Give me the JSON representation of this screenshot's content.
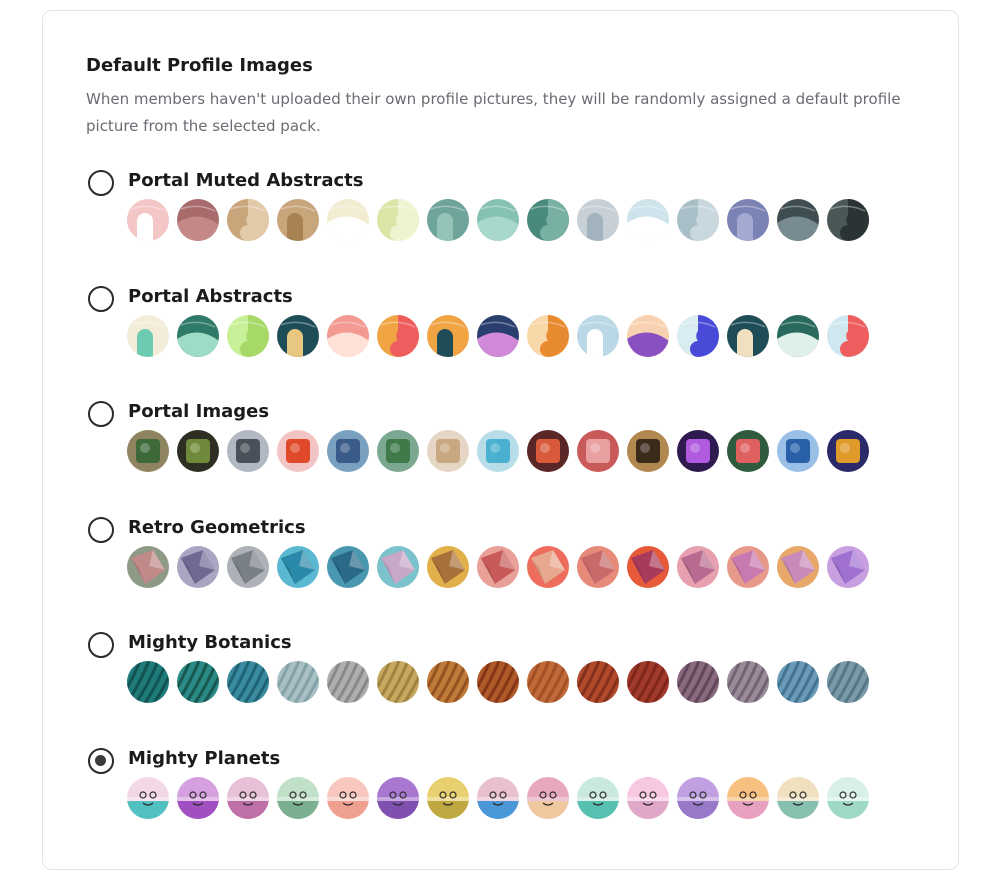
{
  "section": {
    "title": "Default Profile Images",
    "description": "When members haven't uploaded their own profile pictures, they will be randomly assigned a default profile picture from the selected pack."
  },
  "selected_pack": "Mighty Planets",
  "packs": [
    {
      "name": "Portal Muted Abstracts",
      "style": "abstract",
      "swatches": [
        [
          "#f4c6c6",
          "#ffffff"
        ],
        [
          "#a86a6a",
          "#c48888"
        ],
        [
          "#c9a57c",
          "#e2c9a8"
        ],
        [
          "#c9a57c",
          "#a88253"
        ],
        [
          "#f2ecd2",
          "#ffffff"
        ],
        [
          "#d9e6a8",
          "#eef4cf"
        ],
        [
          "#6ea49a",
          "#94c3b8"
        ],
        [
          "#86c2b4",
          "#a8d8cc"
        ],
        [
          "#4a8a7e",
          "#78b0a4"
        ],
        [
          "#c7d0d6",
          "#a3b3bd"
        ],
        [
          "#cfe3ec",
          "#ffffff"
        ],
        [
          "#a9bfc8",
          "#c8d8de"
        ],
        [
          "#7b82b4",
          "#a4a9d2"
        ],
        [
          "#3e4d52",
          "#788b91"
        ],
        [
          "#4b5757",
          "#2b3434"
        ]
      ]
    },
    {
      "name": "Portal Abstracts",
      "style": "abstract",
      "swatches": [
        [
          "#f3ecd9",
          "#6ccbb1"
        ],
        [
          "#2e7a68",
          "#9fdcc6"
        ],
        [
          "#c8f098",
          "#a6d968"
        ],
        [
          "#1f4d57",
          "#e8c880"
        ],
        [
          "#f39a92",
          "#ffe1d8"
        ],
        [
          "#f0a444",
          "#ee5e5e"
        ],
        [
          "#f0a444",
          "#1f4d57"
        ],
        [
          "#2a3f6e",
          "#d08ad8"
        ],
        [
          "#f8d8a8",
          "#e88a30"
        ],
        [
          "#bad7e5",
          "#ffffff"
        ],
        [
          "#f8d2b0",
          "#8a4fc0"
        ],
        [
          "#d9ecf2",
          "#4a4ad8"
        ],
        [
          "#1f4d57",
          "#f1e0c0"
        ],
        [
          "#2a6a5e",
          "#dff0ea"
        ],
        [
          "#cfe8f0",
          "#ee5e5e"
        ]
      ]
    },
    {
      "name": "Portal Images",
      "style": "photo",
      "swatches": [
        [
          "#8f8460",
          "#3e6a3a"
        ],
        [
          "#2e2e22",
          "#6f8a3a"
        ],
        [
          "#b2b8c2",
          "#4a505a"
        ],
        [
          "#f3c4c4",
          "#e04a2a"
        ],
        [
          "#7aa0c0",
          "#3a5a88"
        ],
        [
          "#7aa890",
          "#3e7a4a"
        ],
        [
          "#e6d6c6",
          "#c8a880"
        ],
        [
          "#b6dde8",
          "#4ab0d0"
        ],
        [
          "#5a2626",
          "#d85a3a"
        ],
        [
          "#c85a5a",
          "#e8a0a0"
        ],
        [
          "#b08850",
          "#3a2a1a"
        ],
        [
          "#2e1a4e",
          "#b05ae0"
        ],
        [
          "#2e5a3e",
          "#e06060"
        ],
        [
          "#9ac0e8",
          "#2a60a8"
        ],
        [
          "#2a2a6a",
          "#e09a2a"
        ]
      ]
    },
    {
      "name": "Retro Geometrics",
      "style": "geo",
      "swatches": [
        [
          "#8f9a86",
          "#c08a88"
        ],
        [
          "#a8a6c2",
          "#6e6a92"
        ],
        [
          "#aeb2b8",
          "#7a8088"
        ],
        [
          "#5ab8d0",
          "#2a88a8"
        ],
        [
          "#4a98b0",
          "#2a6a88"
        ],
        [
          "#7ac2cc",
          "#c8a8c8"
        ],
        [
          "#e2b04a",
          "#a8703a"
        ],
        [
          "#e8a098",
          "#c85a5a"
        ],
        [
          "#ee6c5c",
          "#e8a890"
        ],
        [
          "#e88a7a",
          "#c86a6a"
        ],
        [
          "#e65a3a",
          "#a83a5a"
        ],
        [
          "#e6a0b0",
          "#b86a90"
        ],
        [
          "#e89a8a",
          "#c87ab0"
        ],
        [
          "#e8a86a",
          "#c88ab8"
        ],
        [
          "#c8a0e0",
          "#a070d0"
        ]
      ]
    },
    {
      "name": "Mighty Botanics",
      "style": "botanic",
      "swatches": [
        [
          "#1f7a7a",
          "#0e4a4a"
        ],
        [
          "#2a8a86",
          "#164a44"
        ],
        [
          "#3a8aa0",
          "#1a5a6a"
        ],
        [
          "#a8c0c4",
          "#7a9aa0"
        ],
        [
          "#aeaeae",
          "#808080"
        ],
        [
          "#c8a860",
          "#987a3a"
        ],
        [
          "#c07a3a",
          "#8a4a1a"
        ],
        [
          "#b05a2a",
          "#7a2e12"
        ],
        [
          "#c06a3a",
          "#9a4a22"
        ],
        [
          "#b04a2a",
          "#7a2a1a"
        ],
        [
          "#a03a2a",
          "#7a2218"
        ],
        [
          "#8a6a7e",
          "#5a3e52"
        ],
        [
          "#9a8a9a",
          "#6a5a6a"
        ],
        [
          "#6a9ab8",
          "#3a6a8a"
        ],
        [
          "#7a9aa8",
          "#4e6e7e"
        ]
      ]
    },
    {
      "name": "Mighty Planets",
      "style": "planet",
      "swatches": [
        [
          "#f2d8e4",
          "#52c0c0"
        ],
        [
          "#d6a0e0",
          "#a050c0"
        ],
        [
          "#e8c0d8",
          "#c070a8"
        ],
        [
          "#c0e0c8",
          "#7ab090"
        ],
        [
          "#f8c8c0",
          "#f0a090"
        ],
        [
          "#a878d0",
          "#8050b0"
        ],
        [
          "#e8d070",
          "#c0a840"
        ],
        [
          "#e8c0d0",
          "#4a98d8"
        ],
        [
          "#e8a8c0",
          "#f0c8a0"
        ],
        [
          "#c8e8e0",
          "#58c0b0"
        ],
        [
          "#f8c8e0",
          "#e0a8c8"
        ],
        [
          "#c0a0e0",
          "#9878c8"
        ],
        [
          "#f8c080",
          "#e8a0c0"
        ],
        [
          "#f0e0c0",
          "#88c0b0"
        ],
        [
          "#d8f0e8",
          "#a0d8c8"
        ]
      ]
    }
  ]
}
